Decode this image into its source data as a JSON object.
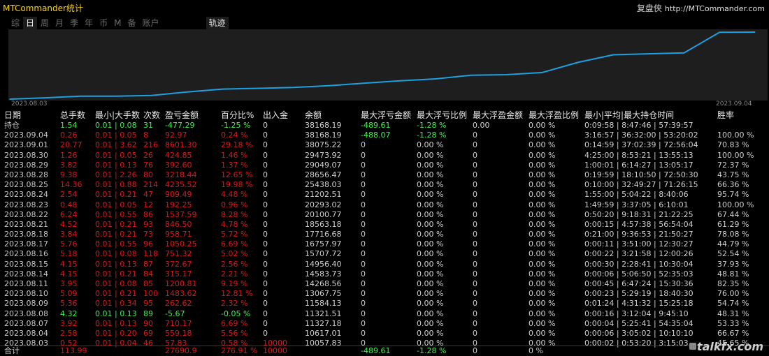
{
  "app": {
    "title": "MTCommander统计",
    "brand": "复盘侠",
    "url": "http://MTCommander.com"
  },
  "tabs": [
    {
      "label": "综",
      "active": false
    },
    {
      "label": "日",
      "active": true
    },
    {
      "label": "周",
      "active": false
    },
    {
      "label": "月",
      "active": false
    },
    {
      "label": "季",
      "active": false
    },
    {
      "label": "年",
      "active": false
    },
    {
      "label": "币",
      "active": false
    },
    {
      "label": "M",
      "active": false
    },
    {
      "label": "备",
      "active": false
    },
    {
      "label": "账户",
      "active": false
    }
  ],
  "track_tab": "轨迹",
  "chart_data": {
    "type": "line",
    "x_start_label": "2023.08.03",
    "x_end_label": "2023.09.04",
    "x": [
      "2023.08.03",
      "2023.08.04",
      "2023.08.07",
      "2023.08.08",
      "2023.08.09",
      "2023.08.10",
      "2023.08.11",
      "2023.08.14",
      "2023.08.15",
      "2023.08.16",
      "2023.08.17",
      "2023.08.18",
      "2023.08.21",
      "2023.08.22",
      "2023.08.23",
      "2023.08.24",
      "2023.08.25",
      "2023.08.28",
      "2023.08.29",
      "2023.08.30",
      "2023.09.01",
      "2023.09.04"
    ],
    "values": [
      10057.83,
      10617.01,
      11327.18,
      11321.51,
      11584.13,
      13067.75,
      14268.56,
      14583.73,
      14956.4,
      15707.72,
      16757.97,
      17716.68,
      18563.18,
      20100.77,
      20293.02,
      21202.51,
      25438.03,
      28656.47,
      29049.07,
      29473.92,
      38075.22,
      38168.19
    ],
    "line_color": "#1e9fe0"
  },
  "table": {
    "headers": [
      "日期",
      "总手数",
      "最小|大手数",
      "次数",
      "盈亏金额",
      "百分比%",
      "出入金",
      "余额",
      "最大浮亏金额",
      "最大浮亏比例",
      "最大浮盈金额",
      "最大浮盈比例",
      "最小|平均|最大持仓时间",
      "胜率"
    ],
    "position_row": {
      "label": "持仓",
      "lots": "1.54",
      "minmax": "0.01 | 0.08",
      "count": "31",
      "pnl": "-477.29",
      "pct": "-1.25 %",
      "inout": "0",
      "balance": "38168.19",
      "max_float_loss": "-489.61",
      "max_float_loss_pct": "-1.28 %",
      "max_float_profit": "0.00",
      "max_float_profit_pct": "0.00 %",
      "hold": "0:09:58 | 8:47:46 | 57:39:57",
      "winrate": ""
    },
    "rows": [
      {
        "date": "2023.09.04",
        "lots": "0.26",
        "minmax": "0.01 | 0.05",
        "count": "8",
        "pnl": "92.97",
        "pct": "0.24 %",
        "inout": "0",
        "balance": "38168.19",
        "mfl": "-488.07",
        "mflp": "-1.28 %",
        "mfp": "0",
        "mfpp": "0.00 %",
        "hold": "3:16:57 | 36:32:00 | 53:20:02",
        "winrate": "100.00 %",
        "positive": true,
        "float_green": true
      },
      {
        "date": "2023.09.01",
        "lots": "20.77",
        "minmax": "0.01 | 3.62",
        "count": "216",
        "pnl": "8601.30",
        "pct": "29.18 %",
        "inout": "0",
        "balance": "38075.22",
        "mfl": "0",
        "mflp": "0.00 %",
        "mfp": "0",
        "mfpp": "0.00 %",
        "hold": "0:14:59 | 37:02:39 | 72:56:04",
        "winrate": "70.83 %",
        "positive": true
      },
      {
        "date": "2023.08.30",
        "lots": "1.26",
        "minmax": "0.01 | 0.05",
        "count": "26",
        "pnl": "424.85",
        "pct": "1.46 %",
        "inout": "0",
        "balance": "29473.92",
        "mfl": "0",
        "mflp": "0.00 %",
        "mfp": "0",
        "mfpp": "0.00 %",
        "hold": "4:25:00 | 8:53:21 | 13:55:13",
        "winrate": "100.00 %",
        "positive": true
      },
      {
        "date": "2023.08.29",
        "lots": "3.82",
        "minmax": "0.01 | 0.13",
        "count": "76",
        "pnl": "392.60",
        "pct": "1.37 %",
        "inout": "0",
        "balance": "29049.07",
        "mfl": "0",
        "mflp": "0.00 %",
        "mfp": "0",
        "mfpp": "0.00 %",
        "hold": "1:00:01 | 6:14:27 | 13:05:17",
        "winrate": "72.37 %",
        "positive": true
      },
      {
        "date": "2023.08.28",
        "lots": "9.38",
        "minmax": "0.01 | 2.26",
        "count": "80",
        "pnl": "3218.44",
        "pct": "12.65 %",
        "inout": "0",
        "balance": "28656.47",
        "mfl": "0",
        "mflp": "0.00 %",
        "mfp": "0",
        "mfpp": "0.00 %",
        "hold": "0:19:59 | 18:10:50 | 72:50:30",
        "winrate": "43.75 %",
        "positive": true
      },
      {
        "date": "2023.08.25",
        "lots": "14.36",
        "minmax": "0.01 | 0.88",
        "count": "214",
        "pnl": "4235.52",
        "pct": "19.98 %",
        "inout": "0",
        "balance": "25438.03",
        "mfl": "0",
        "mflp": "0.00 %",
        "mfp": "0",
        "mfpp": "0.00 %",
        "hold": "0:10:00 | 32:49:27 | 71:26:15",
        "winrate": "66.36 %",
        "positive": true
      },
      {
        "date": "2023.08.24",
        "lots": "2.54",
        "minmax": "0.01 | 0.21",
        "count": "47",
        "pnl": "909.49",
        "pct": "4.48 %",
        "inout": "0",
        "balance": "21202.51",
        "mfl": "0",
        "mflp": "0.00 %",
        "mfp": "0",
        "mfpp": "0.00 %",
        "hold": "1:55:00 | 5:04:22 | 8:40:06",
        "winrate": "95.74 %",
        "positive": true
      },
      {
        "date": "2023.08.23",
        "lots": "0.48",
        "minmax": "0.01 | 0.05",
        "count": "12",
        "pnl": "192.25",
        "pct": "0.96 %",
        "inout": "0",
        "balance": "20293.02",
        "mfl": "0",
        "mflp": "0.00 %",
        "mfp": "0",
        "mfpp": "0.00 %",
        "hold": "1:49:59 | 3:37:05 | 6:10:01",
        "winrate": "100.00 %",
        "positive": true
      },
      {
        "date": "2023.08.22",
        "lots": "6.24",
        "minmax": "0.01 | 0.55",
        "count": "86",
        "pnl": "1537.59",
        "pct": "8.28 %",
        "inout": "0",
        "balance": "20100.77",
        "mfl": "0",
        "mflp": "0.00 %",
        "mfp": "0",
        "mfpp": "0.00 %",
        "hold": "0:50:20 | 9:18:31 | 21:22:25",
        "winrate": "67.44 %",
        "positive": true
      },
      {
        "date": "2023.08.21",
        "lots": "4.52",
        "minmax": "0.01 | 0.21",
        "count": "93",
        "pnl": "846.50",
        "pct": "4.78 %",
        "inout": "0",
        "balance": "18563.18",
        "mfl": "0",
        "mflp": "0.00 %",
        "mfp": "0",
        "mfpp": "0.00 %",
        "hold": "0:00:15 | 4:57:38 | 56:54:04",
        "winrate": "61.29 %",
        "positive": true
      },
      {
        "date": "2023.08.18",
        "lots": "3.84",
        "minmax": "0.01 | 0.21",
        "count": "73",
        "pnl": "958.71",
        "pct": "5.72 %",
        "inout": "0",
        "balance": "17716.68",
        "mfl": "0",
        "mflp": "0.00 %",
        "mfp": "0",
        "mfpp": "0.00 %",
        "hold": "0:21:00 | 9:36:53 | 21:50:27",
        "winrate": "78.08 %",
        "positive": true
      },
      {
        "date": "2023.08.17",
        "lots": "5.76",
        "minmax": "0.01 | 0.55",
        "count": "96",
        "pnl": "1050.25",
        "pct": "6.69 %",
        "inout": "0",
        "balance": "16757.97",
        "mfl": "0",
        "mflp": "0.00 %",
        "mfp": "0",
        "mfpp": "0.00 %",
        "hold": "0:00:11 | 3:51:00 | 12:30:27",
        "winrate": "44.79 %",
        "positive": true
      },
      {
        "date": "2023.08.16",
        "lots": "5.18",
        "minmax": "0.01 | 0.08",
        "count": "118",
        "pnl": "751.32",
        "pct": "5.02 %",
        "inout": "0",
        "balance": "15707.72",
        "mfl": "0",
        "mflp": "0.00 %",
        "mfp": "0",
        "mfpp": "0.00 %",
        "hold": "0:00:22 | 3:21:58 | 12:00:26",
        "winrate": "52.54 %",
        "positive": true
      },
      {
        "date": "2023.08.15",
        "lots": "4.15",
        "minmax": "0.01 | 0.13",
        "count": "87",
        "pnl": "372.67",
        "pct": "2.56 %",
        "inout": "0",
        "balance": "14956.40",
        "mfl": "0",
        "mflp": "0.00 %",
        "mfp": "0",
        "mfpp": "0.00 %",
        "hold": "0:00:30 | 2:28:41 | 10:30:04",
        "winrate": "37.93 %",
        "positive": true
      },
      {
        "date": "2023.08.14",
        "lots": "4.15",
        "minmax": "0.01 | 0.21",
        "count": "84",
        "pnl": "315.17",
        "pct": "2.21 %",
        "inout": "0",
        "balance": "14583.73",
        "mfl": "0",
        "mflp": "0.00 %",
        "mfp": "0",
        "mfpp": "0.00 %",
        "hold": "0:00:06 | 5:06:50 | 52:35:03",
        "winrate": "48.81 %",
        "positive": true
      },
      {
        "date": "2023.08.11",
        "lots": "3.95",
        "minmax": "0.01 | 0.08",
        "count": "85",
        "pnl": "1200.81",
        "pct": "9.19 %",
        "inout": "0",
        "balance": "14268.56",
        "mfl": "0",
        "mflp": "0.00 %",
        "mfp": "0",
        "mfpp": "0.00 %",
        "hold": "0:00:45 | 6:47:24 | 15:30:36",
        "winrate": "82.35 %",
        "positive": true
      },
      {
        "date": "2023.08.10",
        "lots": "5.09",
        "minmax": "0.01 | 0.21",
        "count": "100",
        "pnl": "1483.62",
        "pct": "12.81 %",
        "inout": "0",
        "balance": "13067.75",
        "mfl": "0",
        "mflp": "0.00 %",
        "mfp": "0",
        "mfpp": "0.00 %",
        "hold": "0:00:23 | 5:29:19 | 18:40:30",
        "winrate": "76.00 %",
        "positive": true
      },
      {
        "date": "2023.08.09",
        "lots": "5.36",
        "minmax": "0.01 | 0.34",
        "count": "95",
        "pnl": "262.62",
        "pct": "2.32 %",
        "inout": "0",
        "balance": "11584.13",
        "mfl": "0",
        "mflp": "0.00 %",
        "mfp": "0",
        "mfpp": "0.00 %",
        "hold": "0:01:24 | 4:31:32 | 15:25:18",
        "winrate": "54.74 %",
        "positive": true
      },
      {
        "date": "2023.08.08",
        "lots": "4.32",
        "minmax": "0.01 | 0.13",
        "count": "89",
        "pnl": "-5.67",
        "pct": "-0.05 %",
        "inout": "0",
        "balance": "11321.51",
        "mfl": "0",
        "mflp": "0.00 %",
        "mfp": "0",
        "mfpp": "0.00 %",
        "hold": "0:00:16 | 3:12:04 | 9:45:10",
        "winrate": "48.31 %",
        "positive": false
      },
      {
        "date": "2023.08.07",
        "lots": "3.92",
        "minmax": "0.01 | 0.13",
        "count": "90",
        "pnl": "710.17",
        "pct": "6.69 %",
        "inout": "0",
        "balance": "11327.18",
        "mfl": "0",
        "mflp": "0.00 %",
        "mfp": "0",
        "mfpp": "0.00 %",
        "hold": "0:00:04 | 5:25:41 | 54:35:04",
        "winrate": "53.33 %",
        "positive": true
      },
      {
        "date": "2023.08.04",
        "lots": "2.58",
        "minmax": "0.01 | 0.20",
        "count": "69",
        "pnl": "559.18",
        "pct": "5.56 %",
        "inout": "0",
        "balance": "10617.01",
        "mfl": "0",
        "mflp": "0.00 %",
        "mfp": "0",
        "mfpp": "0.00 %",
        "hold": "0:00:06 | 3:05:02 | 10:10:10",
        "winrate": "66.67 %",
        "positive": true
      },
      {
        "date": "2023.08.03",
        "lots": "0.52",
        "minmax": "0.01 | 0.04",
        "count": "46",
        "pnl": "57.83",
        "pct": "0.58 %",
        "inout": "10000",
        "balance": "10057.83",
        "mfl": "0",
        "mflp": "0.00 %",
        "mfp": "0",
        "mfpp": "0.00 %",
        "hold": "0:00:02 | 0:53:20 | 3:15:03",
        "winrate": "45.65 %",
        "positive": true
      }
    ],
    "summary": {
      "label": "合计",
      "lots": "113.99",
      "pnl": "27690.9",
      "pct": "276.91 %",
      "inout": "10000",
      "mfl": "-489.61",
      "mflp": "-1.28 %",
      "mfp": "0",
      "mfpp": "0 %"
    }
  },
  "watermark": "talkfx.com"
}
